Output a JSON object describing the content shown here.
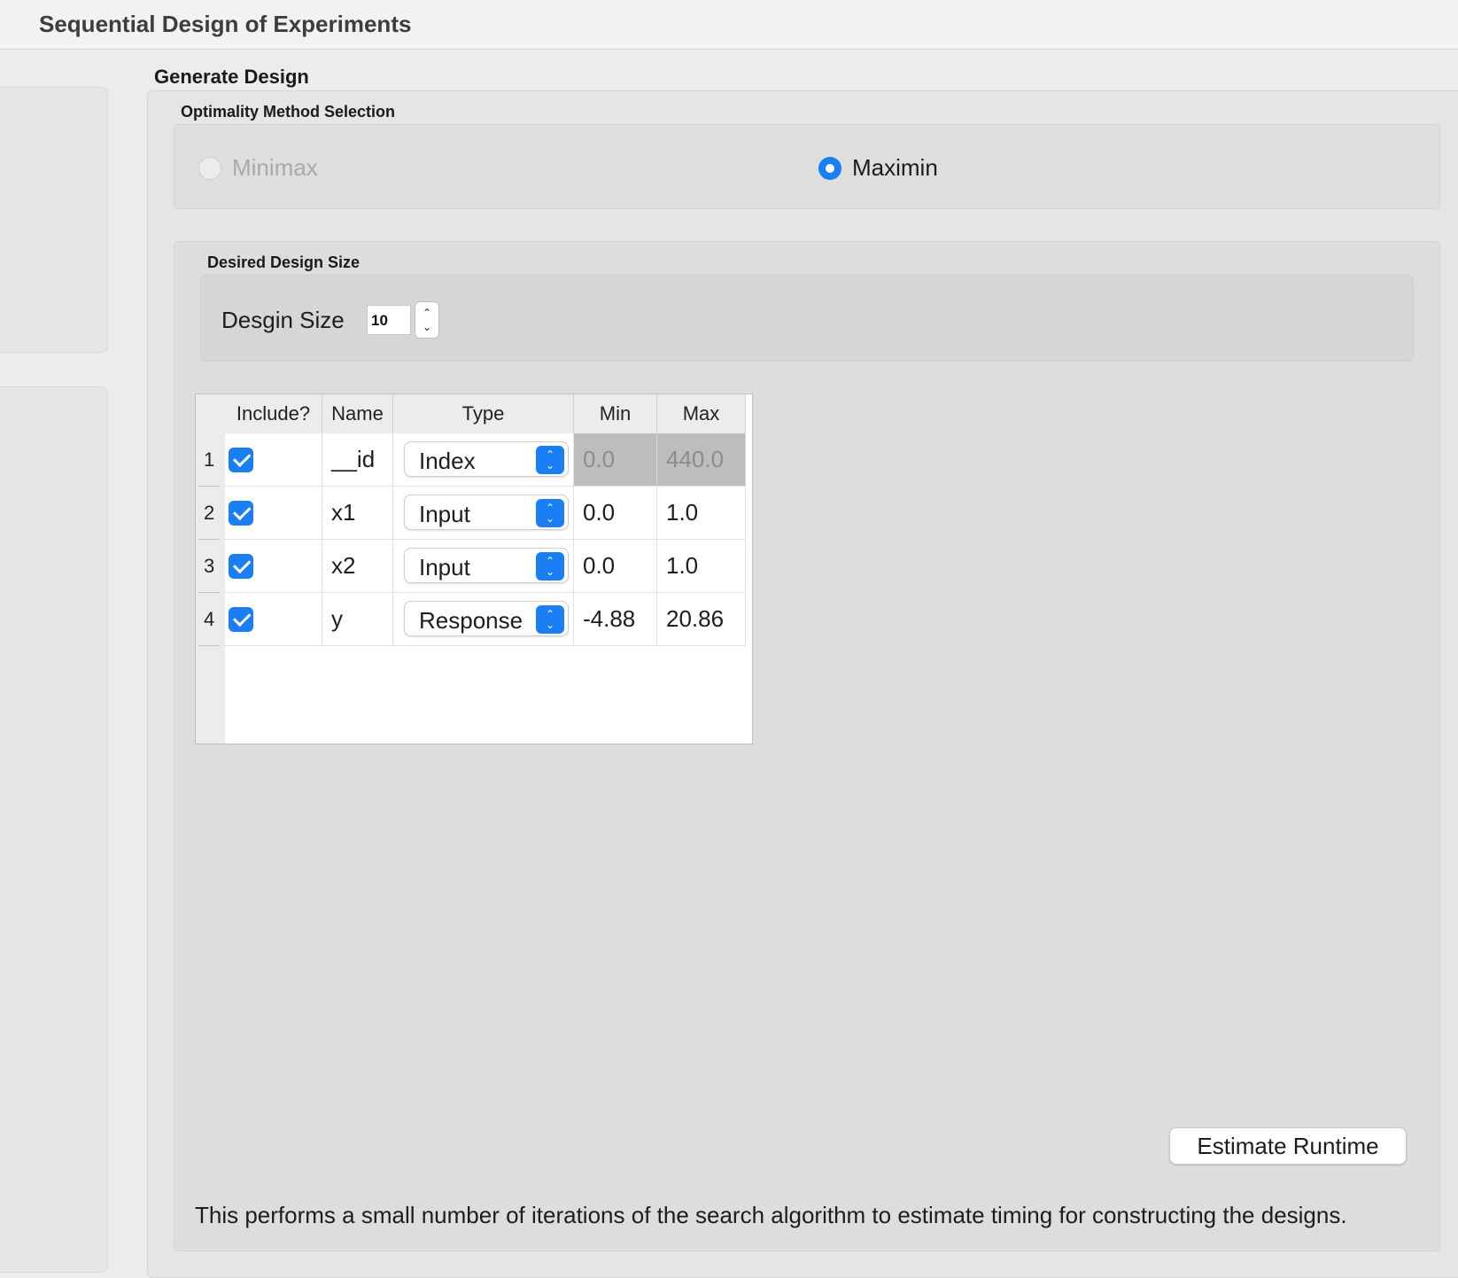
{
  "window": {
    "title": "Sequential Design of Experiments"
  },
  "generate_design": {
    "title": "Generate Design",
    "optimality": {
      "title": "Optimality Method Selection",
      "options": [
        {
          "label": "Minimax",
          "selected": false,
          "enabled": false
        },
        {
          "label": "Maximin",
          "selected": true,
          "enabled": true
        }
      ]
    },
    "design_size": {
      "title": "Desired Design Size",
      "label": "Desgin Size",
      "value": "10"
    },
    "table": {
      "columns": [
        "Include?",
        "Name",
        "Type",
        "Min",
        "Max"
      ],
      "rows": [
        {
          "num": "1",
          "include": true,
          "name": "__id",
          "type": "Index",
          "min": "0.0",
          "max": "440.0"
        },
        {
          "num": "2",
          "include": true,
          "name": "x1",
          "type": "Input",
          "min": "0.0",
          "max": "1.0"
        },
        {
          "num": "3",
          "include": true,
          "name": "x2",
          "type": "Input",
          "min": "0.0",
          "max": "1.0"
        },
        {
          "num": "4",
          "include": true,
          "name": "y",
          "type": "Response",
          "min": "-4.88",
          "max": "20.86"
        }
      ]
    },
    "estimate_button": "Estimate Runtime",
    "description": "This performs a small number of iterations of the search algorithm to estimate timing for constructing the designs."
  },
  "colors": {
    "accent": "#1a7ef5",
    "disabled_cell": "#bdbdbd"
  },
  "icons": {
    "checkbox": "checkmark-icon",
    "combo": "up-down-chevron-icon",
    "stepper": "chevron-up-down-icon"
  }
}
